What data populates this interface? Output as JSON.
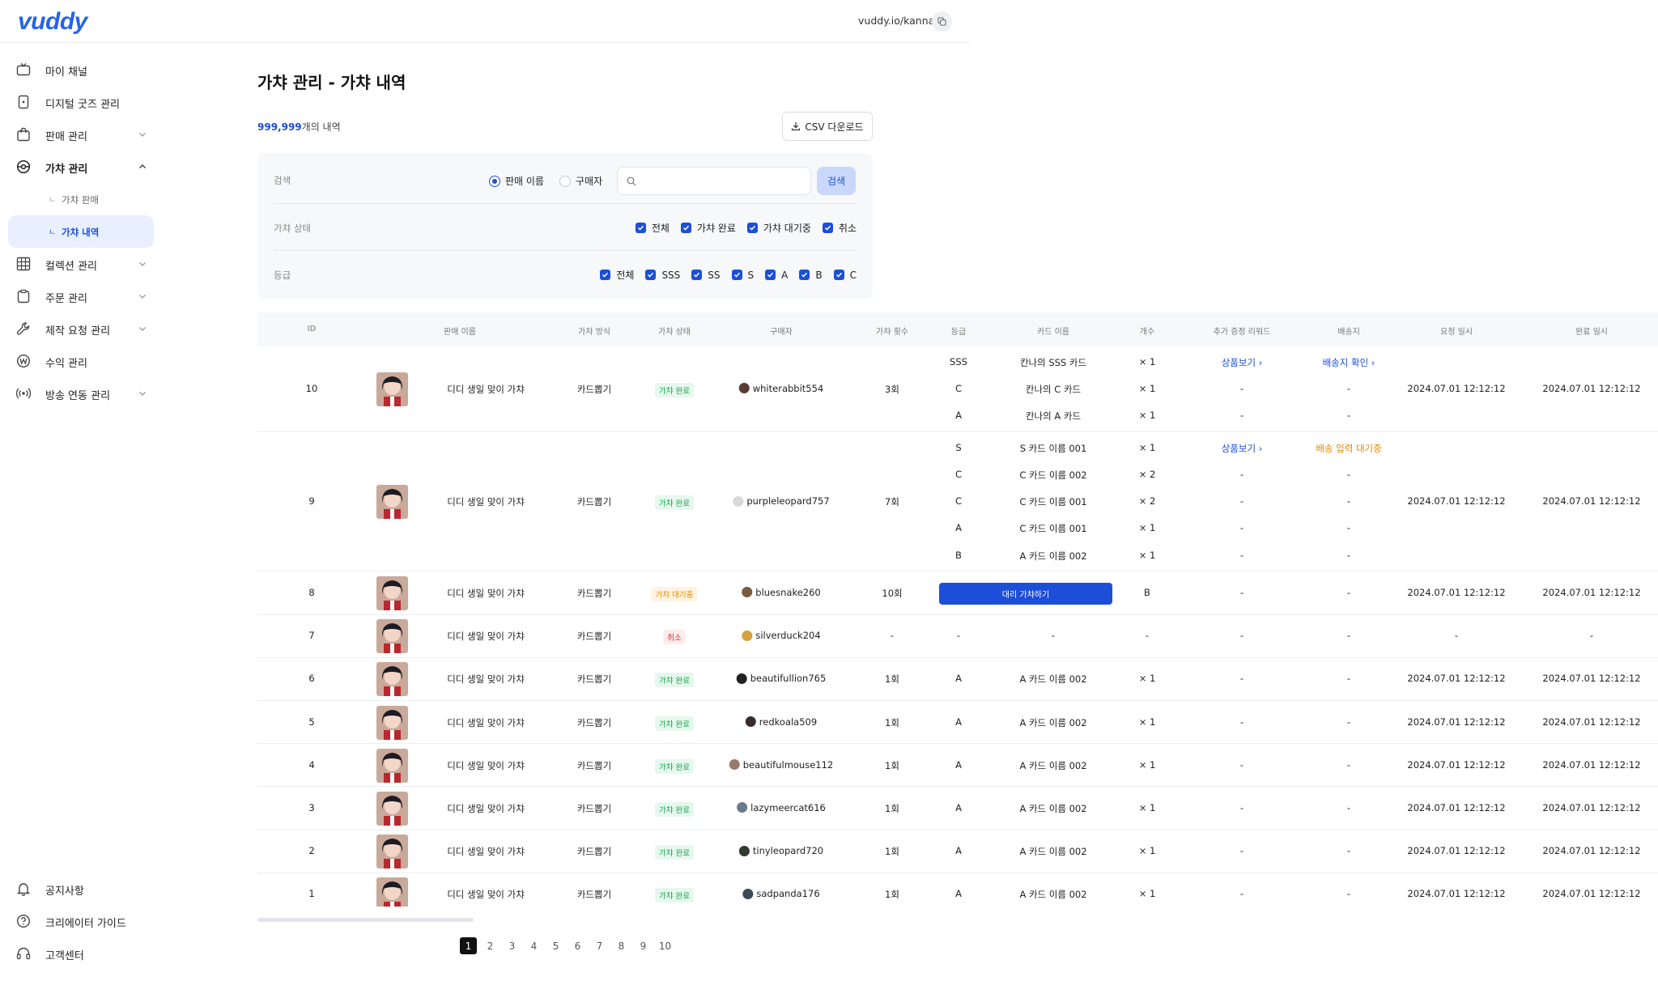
{
  "app": {
    "logo": "vuddy",
    "channel_url": "vuddy.io/kanna"
  },
  "colors": {
    "accent": "#1d4ed8",
    "done": "#16a34a",
    "wait": "#e08a00",
    "cancel": "#dc2626"
  },
  "sidebar": {
    "items": [
      {
        "label": "마이 채널",
        "icon": "tv-icon"
      },
      {
        "label": "디지털 굿즈 관리",
        "icon": "card-icon"
      },
      {
        "label": "판매 관리",
        "icon": "bag-icon",
        "chevron": "down"
      },
      {
        "label": "가챠 관리",
        "icon": "gacha-icon",
        "chevron": "up"
      },
      {
        "label": "컬렉션 관리",
        "icon": "grid-icon",
        "chevron": "down"
      },
      {
        "label": "주문 관리",
        "icon": "clipboard-icon",
        "chevron": "down"
      },
      {
        "label": "제작 요청 관리",
        "icon": "wrench-icon",
        "chevron": "down"
      },
      {
        "label": "수익 관리",
        "icon": "won-icon"
      },
      {
        "label": "방송 연동 관리",
        "icon": "broadcast-icon",
        "chevron": "down"
      }
    ],
    "sub_items": [
      {
        "label": "가챠 판매"
      },
      {
        "label": "가챠 내역"
      }
    ],
    "bottom": [
      {
        "label": "공지사항",
        "icon": "bell-icon"
      },
      {
        "label": "크리에이터 가이드",
        "icon": "help-icon"
      },
      {
        "label": "고객센터",
        "icon": "headset-icon"
      }
    ]
  },
  "main": {
    "title": "가챠 관리 - 가챠 내역",
    "count_num": "999,999",
    "count_suffix": "개의 내역",
    "csv_label": "CSV 다운로드"
  },
  "filter": {
    "search_label": "검색",
    "radio_sale": "판매 이름",
    "radio_buyer": "구매자",
    "search_value": "",
    "search_button": "검색",
    "status_label": "가챠 상태",
    "status_options": [
      "전체",
      "가챠 완료",
      "가챠 대기중",
      "취소"
    ],
    "grade_label": "등급",
    "grade_options": [
      "전체",
      "SSS",
      "SS",
      "S",
      "A",
      "B",
      "C"
    ]
  },
  "table": {
    "headers": [
      "ID",
      "판매 이름",
      "가챠 방식",
      "가챠 상태",
      "구매자",
      "가챠 횟수",
      "등급",
      "카드 이름",
      "개수",
      "추가 증정 리워드",
      "배송지",
      "요청 일시",
      "완료 일시"
    ],
    "rows": [
      {
        "id": "10",
        "sale": "디디 생일 맞이 가챠",
        "method": "카드뽑기",
        "status": "가챠 완료",
        "buyer": "whiterabbit554",
        "count": "3회",
        "req": "2024.07.01 12:12:12",
        "fin": "2024.07.01 12:12:12",
        "subs": [
          {
            "grade": "SSS",
            "card": "칸나의 SSS 카드",
            "qty": "× 1",
            "reward": "상품보기",
            "ship": "배송지 확인"
          },
          {
            "grade": "C",
            "card": "칸나의 C 카드",
            "qty": "× 1",
            "reward": "-",
            "ship": "-"
          },
          {
            "grade": "A",
            "card": "칸나의 A 카드",
            "qty": "× 1",
            "reward": "-",
            "ship": "-"
          }
        ]
      },
      {
        "id": "9",
        "sale": "디디 생일 맞이 가챠",
        "method": "카드뽑기",
        "status": "가챠 완료",
        "buyer": "purpleleopard757",
        "count": "7회",
        "req": "2024.07.01 12:12:12",
        "fin": "2024.07.01 12:12:12",
        "subs": [
          {
            "grade": "S",
            "card": "S 카드 이름 001",
            "qty": "× 1",
            "reward": "상품보기",
            "ship": "배송 입력 대기중"
          },
          {
            "grade": "C",
            "card": "C  카드 이름 002",
            "qty": "× 2",
            "reward": "-",
            "ship": "-"
          },
          {
            "grade": "C",
            "card": "C  카드 이름 001",
            "qty": "× 2",
            "reward": "-",
            "ship": "-"
          },
          {
            "grade": "A",
            "card": "C  카드 이름 001",
            "qty": "× 1",
            "reward": "-",
            "ship": "-"
          },
          {
            "grade": "B",
            "card": "A  카드 이름 002",
            "qty": "× 1",
            "reward": "-",
            "ship": "-"
          }
        ]
      },
      {
        "id": "8",
        "sale": "디디 생일 맞이 가챠",
        "method": "카드뽑기",
        "status": "가챠 대기중",
        "buyer": "bluesnake260",
        "count": "10회",
        "proxy": "대리 가챠하기",
        "qty": "B",
        "reward": "-",
        "ship": "-",
        "req": "2024.07.01 12:12:12",
        "fin": "2024.07.01 12:12:12"
      },
      {
        "id": "7",
        "sale": "디디 생일 맞이 가챠",
        "method": "카드뽑기",
        "status": "취소",
        "buyer": "silverduck204",
        "count": "-",
        "grade": "-",
        "card": "-",
        "qty": "-",
        "reward": "-",
        "ship": "-",
        "req": "-",
        "fin": "-"
      },
      {
        "id": "6",
        "sale": "디디 생일 맞이 가챠",
        "method": "카드뽑기",
        "status": "가챠 완료",
        "buyer": "beautifullion765",
        "count": "1회",
        "grade": "A",
        "card": "A  카드 이름 002",
        "qty": "× 1",
        "reward": "-",
        "ship": "-",
        "req": "2024.07.01 12:12:12",
        "fin": "2024.07.01 12:12:12"
      },
      {
        "id": "5",
        "sale": "디디 생일 맞이 가챠",
        "method": "카드뽑기",
        "status": "가챠 완료",
        "buyer": "redkoala509",
        "count": "1회",
        "grade": "A",
        "card": "A  카드 이름 002",
        "qty": "× 1",
        "reward": "-",
        "ship": "-",
        "req": "2024.07.01 12:12:12",
        "fin": "2024.07.01 12:12:12"
      },
      {
        "id": "4",
        "sale": "디디 생일 맞이 가챠",
        "method": "카드뽑기",
        "status": "가챠 완료",
        "buyer": "beautifulmouse112",
        "count": "1회",
        "grade": "A",
        "card": "A  카드 이름 002",
        "qty": "× 1",
        "reward": "-",
        "ship": "-",
        "req": "2024.07.01 12:12:12",
        "fin": "2024.07.01 12:12:12"
      },
      {
        "id": "3",
        "sale": "디디 생일 맞이 가챠",
        "method": "카드뽑기",
        "status": "가챠 완료",
        "buyer": "lazymeercat616",
        "count": "1회",
        "grade": "A",
        "card": "A  카드 이름 002",
        "qty": "× 1",
        "reward": "-",
        "ship": "-",
        "req": "2024.07.01 12:12:12",
        "fin": "2024.07.01 12:12:12"
      },
      {
        "id": "2",
        "sale": "디디 생일 맞이 가챠",
        "method": "카드뽑기",
        "status": "가챠 완료",
        "buyer": "tinyleopard720",
        "count": "1회",
        "grade": "A",
        "card": "A  카드 이름 002",
        "qty": "× 1",
        "reward": "-",
        "ship": "-",
        "req": "2024.07.01 12:12:12",
        "fin": "2024.07.01 12:12:12"
      },
      {
        "id": "1",
        "sale": "디디 생일 맞이 가챠",
        "method": "카드뽑기",
        "status": "가챠 완료",
        "buyer": "sadpanda176",
        "count": "1회",
        "grade": "A",
        "card": "A  카드 이름 002",
        "qty": "× 1",
        "reward": "-",
        "ship": "-",
        "req": "2024.07.01 12:12:12",
        "fin": "2024.07.01 12:12:12"
      }
    ]
  },
  "pagination": {
    "pages": [
      "1",
      "2",
      "3",
      "4",
      "5",
      "6",
      "7",
      "8",
      "9",
      "10"
    ],
    "current": "1"
  }
}
